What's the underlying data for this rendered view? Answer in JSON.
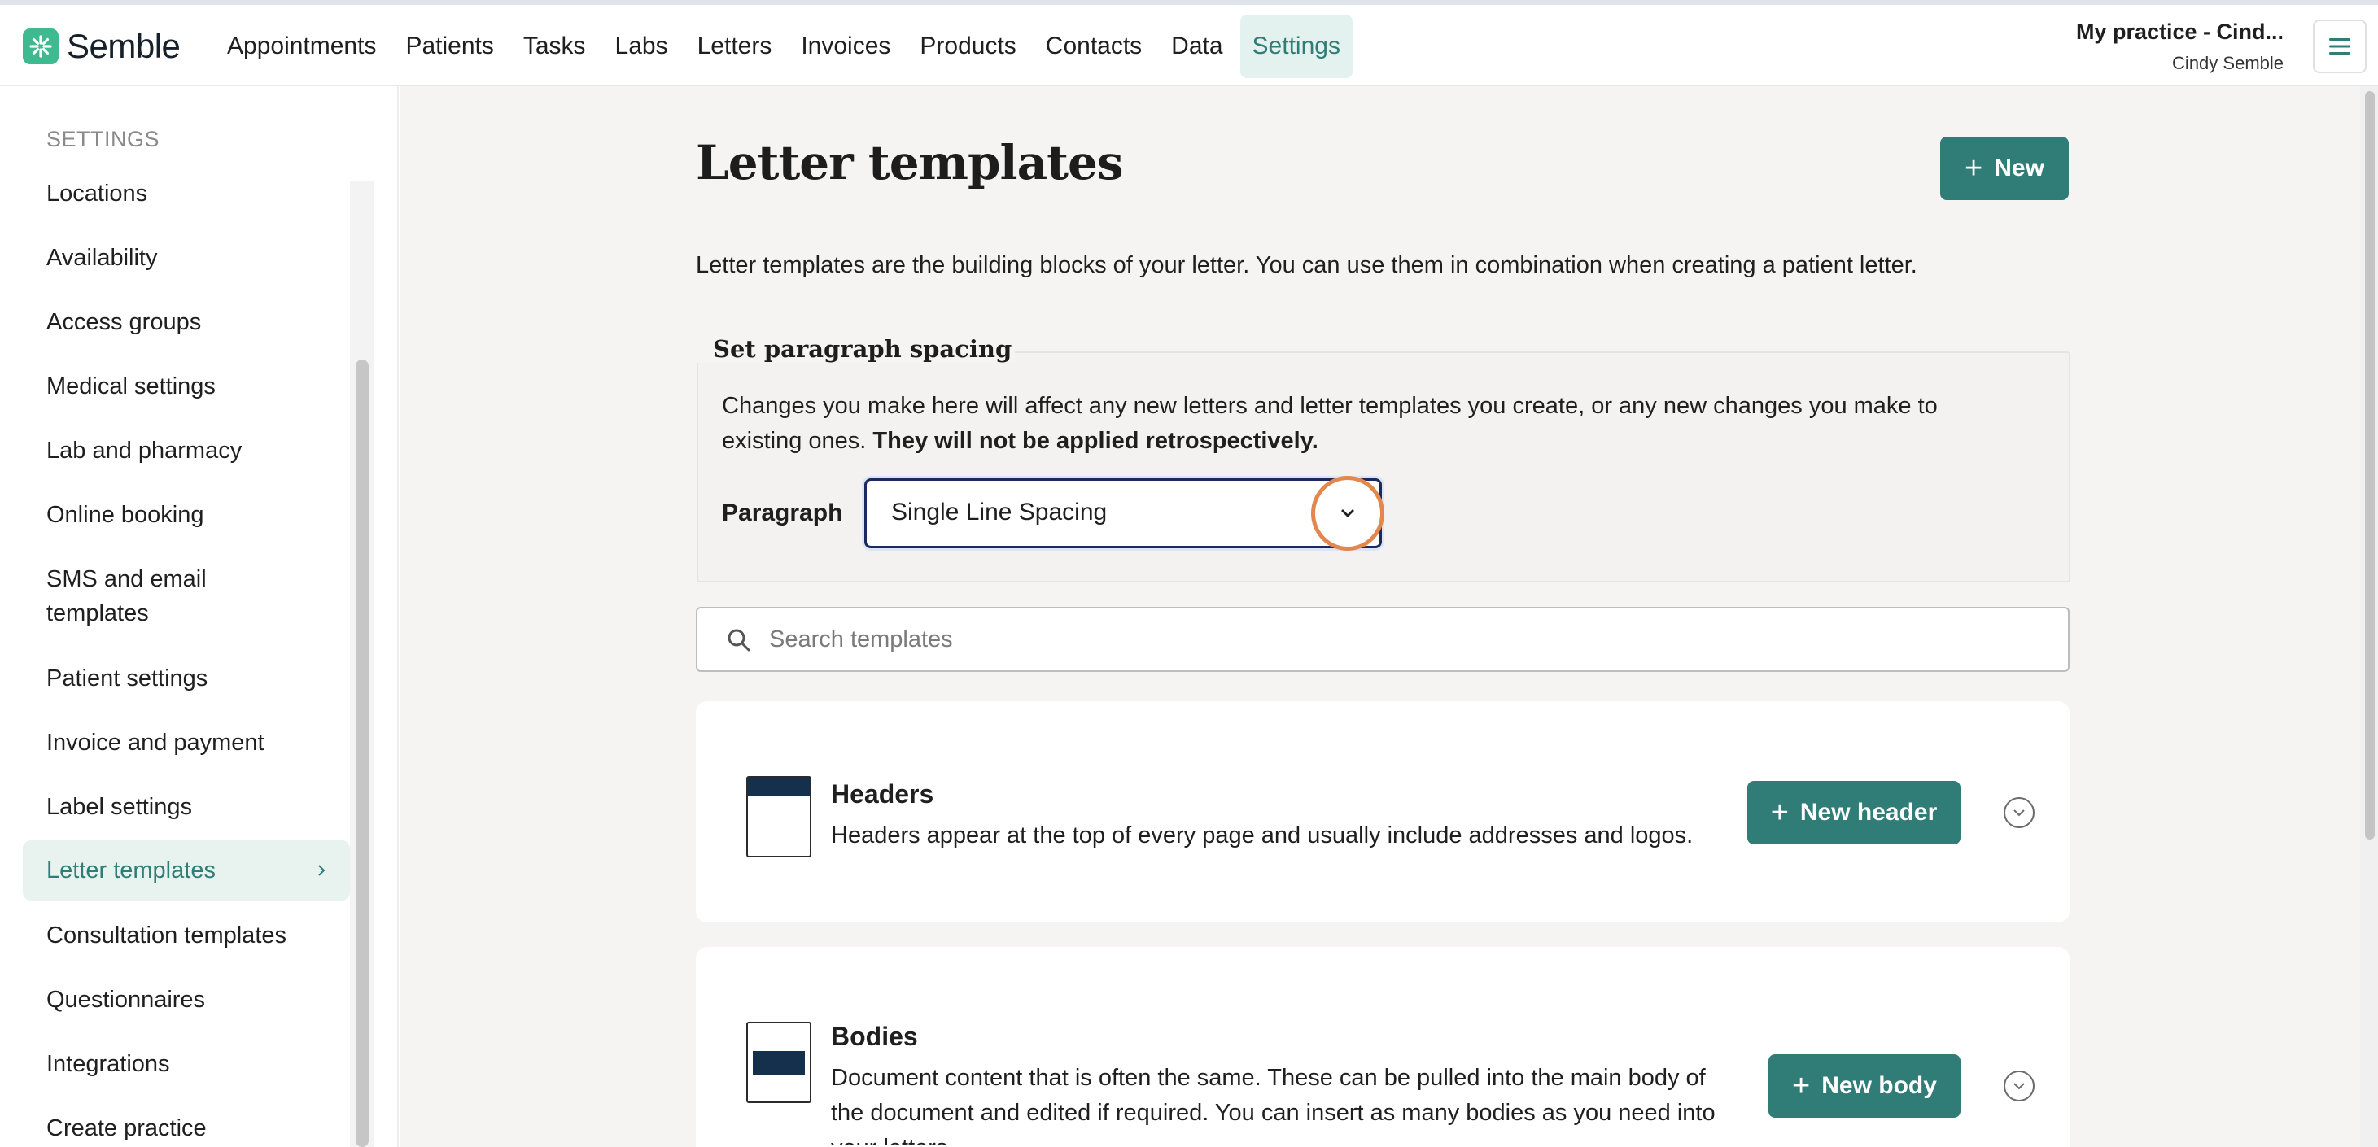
{
  "brand": {
    "name": "Semble",
    "color": "#3fb98f"
  },
  "nav": {
    "items": [
      "Appointments",
      "Patients",
      "Tasks",
      "Labs",
      "Letters",
      "Invoices",
      "Products",
      "Contacts",
      "Data",
      "Settings"
    ],
    "active": "Settings"
  },
  "account": {
    "practice": "My practice - Cind...",
    "user": "Cindy Semble"
  },
  "sidebar": {
    "heading": "SETTINGS",
    "items": [
      {
        "label": "Locations"
      },
      {
        "label": "Availability"
      },
      {
        "label": "Access groups"
      },
      {
        "label": "Medical settings"
      },
      {
        "label": "Lab and pharmacy"
      },
      {
        "label": "Online booking"
      },
      {
        "label": "SMS and email templates"
      },
      {
        "label": "Patient settings"
      },
      {
        "label": "Invoice and payment"
      },
      {
        "label": "Label settings"
      },
      {
        "label": "Letter templates",
        "active": true
      },
      {
        "label": "Consultation templates"
      },
      {
        "label": "Questionnaires"
      },
      {
        "label": "Integrations"
      },
      {
        "label": "Create practice"
      }
    ]
  },
  "main": {
    "title": "Letter templates",
    "new_button": "New",
    "intro": "Letter templates are the building blocks of your letter. You can use them in combination when creating a patient letter.",
    "spacing": {
      "legend": "Set paragraph spacing",
      "text": "Changes you make here will affect any new letters and letter templates you create, or any new changes you make to existing ones.",
      "text_bold": "They will not be applied retrospectively.",
      "paragraph_label": "Paragraph",
      "selected": "Single Line Spacing"
    },
    "search": {
      "placeholder": "Search templates"
    },
    "sections": [
      {
        "title": "Headers",
        "description": "Headers appear at the top of every page and usually include addresses and logos.",
        "button": "New header"
      },
      {
        "title": "Bodies",
        "description": "Document content that is often the same. These can be pulled into the main body of the document and edited if required. You can insert as many bodies as you need into your letters.",
        "button": "New body"
      }
    ]
  },
  "colors": {
    "accent": "#2f7d76",
    "accent_light": "#e3f2ee",
    "highlight_ring": "#e2874e",
    "doc_band": "#14304d"
  },
  "icons": {
    "search": "search-icon",
    "menu": "hamburger-menu-icon",
    "chevron": "chevron-down-icon",
    "expand": "chevron-circle-down-icon"
  }
}
